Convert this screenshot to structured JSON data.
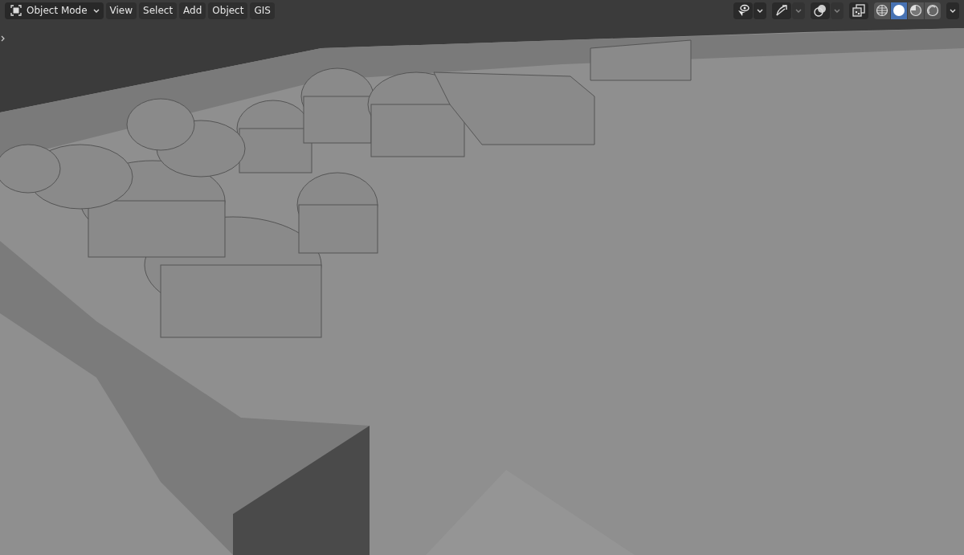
{
  "header": {
    "mode_menu": {
      "label": "Object Mode"
    },
    "menus": [
      "View",
      "Select",
      "Add",
      "Object",
      "GIS"
    ],
    "shading_modes": [
      {
        "kind": "wireframe",
        "selected": false
      },
      {
        "kind": "solid",
        "selected": true
      },
      {
        "kind": "material",
        "selected": false
      },
      {
        "kind": "rendered",
        "selected": false
      }
    ]
  }
}
